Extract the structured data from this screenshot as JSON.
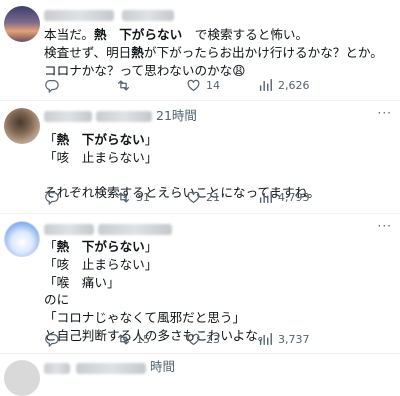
{
  "tweets": [
    {
      "time": "",
      "lines": [
        [
          {
            "t": "本当だ。"
          },
          {
            "t": "熱　下がらない",
            "b": true
          },
          {
            "t": "　で検索すると怖い。"
          }
        ],
        [
          {
            "t": "検査せず、明日"
          },
          {
            "t": "熱",
            "b": true
          },
          {
            "t": "が下がったらお出かけ行けるかな？とか。"
          }
        ],
        [
          {
            "t": "コロナかな？って思わないのかな😩"
          }
        ]
      ],
      "counts": {
        "reply": "",
        "retweet": "",
        "like": "14",
        "views": "2,626"
      }
    },
    {
      "time": "21時間",
      "lines": [
        [
          {
            "t": "「"
          },
          {
            "t": "熱　下がらない",
            "b": true
          },
          {
            "t": "」"
          }
        ],
        [
          {
            "t": "「咳　止まらない」"
          }
        ],
        [
          {
            "t": ""
          }
        ],
        [
          {
            "t": "それぞれ検索するとえらいことになってますね。"
          }
        ]
      ],
      "counts": {
        "reply": "",
        "retweet": "31",
        "like": "21",
        "views": "4,793"
      }
    },
    {
      "time": "",
      "lines": [
        [
          {
            "t": "「"
          },
          {
            "t": "熱　下がらない",
            "b": true
          },
          {
            "t": "」"
          }
        ],
        [
          {
            "t": "「咳　止まらない」"
          }
        ],
        [
          {
            "t": "「喉　痛い」"
          }
        ],
        [
          {
            "t": "のに"
          }
        ],
        [
          {
            "t": "「コロナじゃなくて風邪だと思う」"
          }
        ],
        [
          {
            "t": "と自己判断する人の多さもこわいよな。"
          }
        ]
      ],
      "counts": {
        "reply": "",
        "retweet": "15",
        "like": "23",
        "views": "3,737"
      }
    },
    {
      "time": "時間",
      "lines": [],
      "counts": {}
    }
  ],
  "icons": {
    "reply": "reply-icon",
    "retweet": "retweet-icon",
    "like": "like-icon",
    "views": "views-icon",
    "more": "more-icon"
  },
  "more_glyph": "···",
  "colors": {
    "text": "#0f1419",
    "secondary": "#536471",
    "border": "#eff3f4"
  }
}
